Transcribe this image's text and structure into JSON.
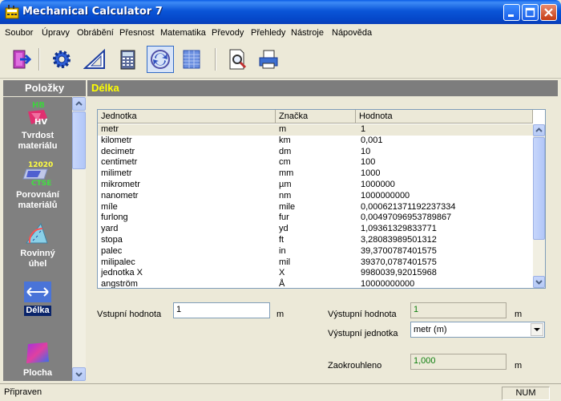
{
  "window": {
    "title": "Mechanical Calculator 7"
  },
  "menu": [
    "Soubor",
    "Úpravy",
    "Obrábění",
    "Přesnost",
    "Matematika",
    "Převody",
    "Přehledy",
    "Nástroje",
    "Nápověda"
  ],
  "toolbar": {
    "tools": [
      "exit-icon",
      "gear-icon",
      "triangle-ruler-icon",
      "calculator-icon",
      "conversion-icon",
      "table-sheet-icon",
      "print-preview-icon",
      "printer-icon"
    ]
  },
  "sidebar": {
    "header": "Položky",
    "items": [
      {
        "label1": "Tvrdost",
        "label2": "materiálu",
        "icon": "hardness-icon",
        "icon_text_top": "HB",
        "icon_text_bottom": "HV"
      },
      {
        "label1": "Porovnání",
        "label2": "materiálů",
        "icon": "material-compare-icon",
        "icon_text_top": "12020",
        "icon_text_bottom": "CTSE"
      },
      {
        "label1": "Rovinný",
        "label2": "úhel",
        "icon": "plane-angle-icon"
      },
      {
        "label1": "Délka",
        "label2": "",
        "icon": "length-icon",
        "selected": true
      },
      {
        "label1": "Plocha",
        "label2": "",
        "icon": "area-icon"
      }
    ]
  },
  "main": {
    "title": "Délka",
    "table": {
      "columns": [
        "Jednotka",
        "Značka",
        "Hodnota"
      ],
      "rows": [
        [
          "metr",
          "m",
          "1"
        ],
        [
          "kilometr",
          "km",
          "0,001"
        ],
        [
          "decimetr",
          "dm",
          "10"
        ],
        [
          "centimetr",
          "cm",
          "100"
        ],
        [
          "milimetr",
          "mm",
          "1000"
        ],
        [
          "mikrometr",
          "µm",
          "1000000"
        ],
        [
          "nanometr",
          "nm",
          "1000000000"
        ],
        [
          "míle",
          "mile",
          "0,000621371192237334"
        ],
        [
          "furlong",
          "fur",
          "0,00497096953789867"
        ],
        [
          "yard",
          "yd",
          "1,09361329833771"
        ],
        [
          "stopa",
          "ft",
          "3,28083989501312"
        ],
        [
          "palec",
          "in",
          "39,3700787401575"
        ],
        [
          "milipalec",
          "mil",
          "39370,0787401575"
        ],
        [
          "jednotka X",
          "X",
          "9980039,92015968"
        ],
        [
          "angström",
          "Å",
          "10000000000"
        ]
      ]
    },
    "form": {
      "input_label": "Vstupní hodnota",
      "input_value": "1",
      "input_unit": "m",
      "output_label": "Výstupní hodnota",
      "output_value": "1",
      "output_unit": "m",
      "output_unit_label": "Výstupní jednotka",
      "output_unit_selected": "metr (m)",
      "rounded_label": "Zaokrouhleno",
      "rounded_value": "1,000",
      "rounded_unit": "m"
    }
  },
  "status": {
    "text": "Připraven",
    "num": "NUM"
  }
}
